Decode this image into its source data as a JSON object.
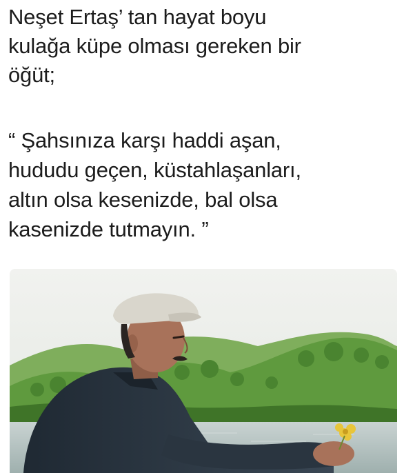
{
  "post": {
    "intro_lines": [
      "Neşet Ertaş’ tan hayat boyu",
      "kulağa küpe olması gereken bir",
      "öğüt;"
    ],
    "quote_lines": [
      "“ Şahsınıza karşı haddi aşan,",
      "hududu geçen, küstahlaşanları,",
      "altın olsa kesenizde, bal olsa",
      "kasenizde tutmayın. ”"
    ]
  },
  "photo": {
    "subject": "man in flat cap holding a yellow flower by a lake",
    "colors": {
      "sky": "#eef0ec",
      "hills": "#5f9a3e",
      "hills_dark": "#3f7428",
      "water": "#b9c6c6",
      "jacket": "#2f3b47",
      "cap": "#d9d6cc",
      "skin": "#a8725a",
      "flower": "#e8c53a"
    }
  }
}
